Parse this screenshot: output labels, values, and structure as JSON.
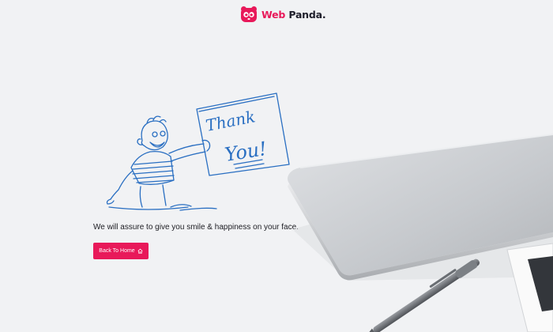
{
  "brand": {
    "name_part1": "Web",
    "name_part2": " Panda.",
    "accent_color": "#e8195a",
    "icon": "panda-logo-icon"
  },
  "illustration": {
    "sign_line1": "Thank",
    "sign_line2": "You!",
    "ink_color": "#2a6fc2"
  },
  "main": {
    "tagline": "We will assure to give you smile & happiness on your face.",
    "button_label": "Back To Home",
    "button_icon": "home-icon"
  }
}
